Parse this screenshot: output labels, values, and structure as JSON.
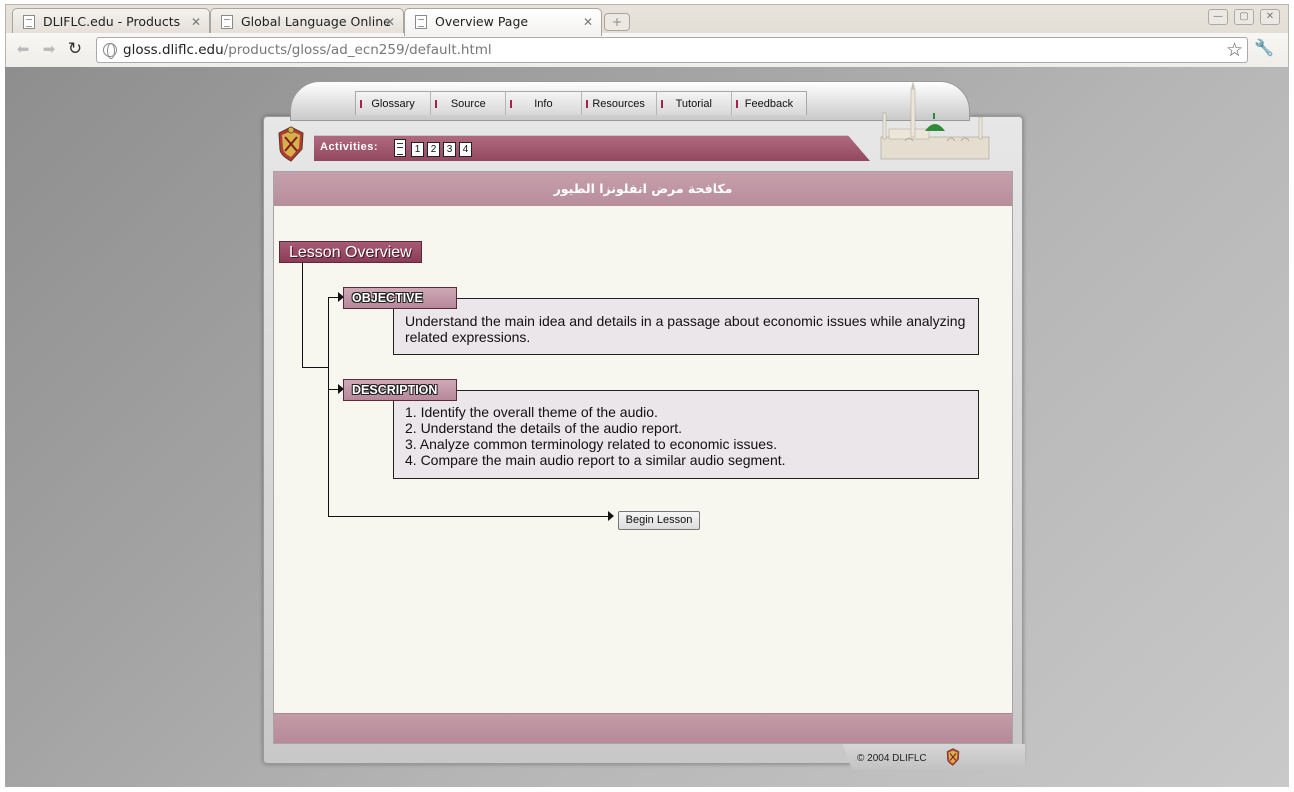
{
  "browser": {
    "tabs": [
      {
        "title": "DLIFLC.edu - Products"
      },
      {
        "title": "Global Language Online"
      },
      {
        "title": "Overview Page"
      }
    ],
    "url_host": "gloss.dliflc.edu",
    "url_path": "/products/gloss/ad_ecn259/default.html"
  },
  "nav": {
    "items": [
      "Glossary",
      "Source",
      "Info",
      "Resources",
      "Tutorial",
      "Feedback"
    ]
  },
  "activities": {
    "label": "Activities:",
    "numbers": [
      "1",
      "2",
      "3",
      "4"
    ]
  },
  "lesson": {
    "arabic_title": "مكافحة مرض انفلونزا الطيور",
    "overview_title": "Lesson Overview",
    "objective_label": "OBJECTIVE",
    "objective_text": "Understand the main idea and details in a passage about economic issues while analyzing related expressions.",
    "description_label": "DESCRIPTION",
    "description_items": [
      "1.  Identify the overall theme of the audio.",
      "2.  Understand the details of the audio report.",
      "3.  Analyze common terminology related to economic issues.",
      "4.  Compare the main audio report to a similar audio segment."
    ],
    "begin_label": "Begin Lesson"
  },
  "footer": {
    "copyright": "© 2004 DLIFLC"
  },
  "colors": {
    "accent": "#9b4f68",
    "band": "#bd939f",
    "content_bg": "#f8f7ef"
  }
}
